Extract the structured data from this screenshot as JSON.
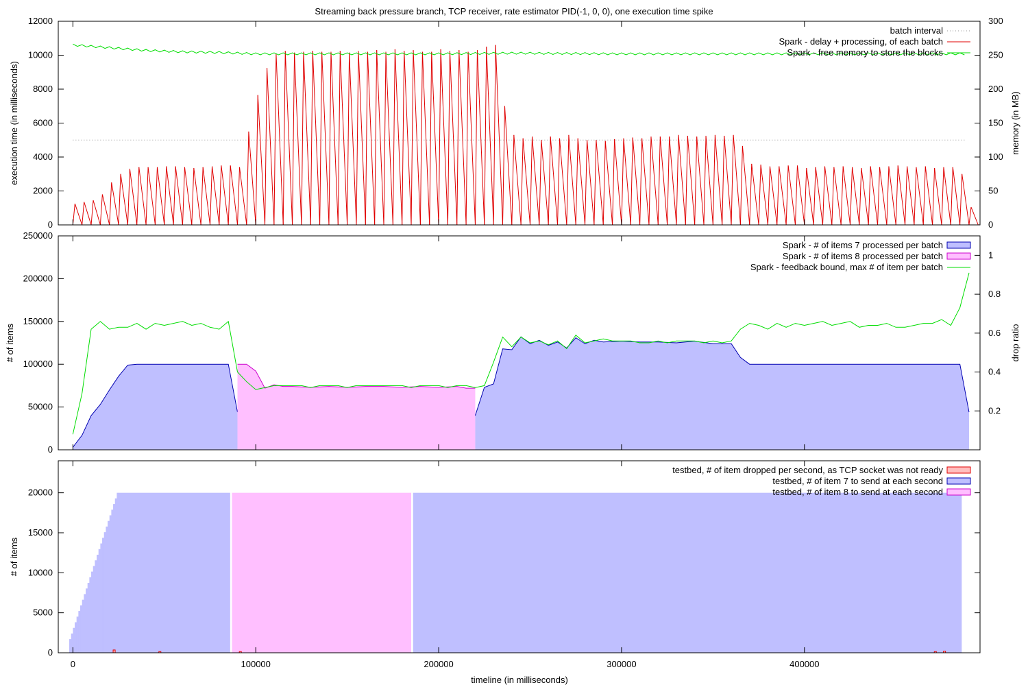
{
  "title": "Streaming back pressure branch, TCP receiver, rate estimator PID(-1, 0, 0), one execution time spike",
  "x_label": "timeline (in milliseconds)",
  "x_ticks": [
    0,
    100000,
    200000,
    300000,
    400000
  ],
  "x_tick_labels": [
    "0",
    "100000",
    "200000",
    "300000",
    "400000"
  ],
  "colors": {
    "red": "#e00000",
    "green": "#00dd00",
    "blue": "#0000b0",
    "blue_fill": "#bfbfff",
    "pink": "#ffbfff",
    "pink_edge": "#cc00cc",
    "drop_fill": "#ffbfbf"
  },
  "chart_data": [
    {
      "type": "line",
      "panel": "execution",
      "xlim": [
        -8000,
        496000
      ],
      "ylim": [
        0,
        12000
      ],
      "y2lim": [
        0,
        300
      ],
      "ylabel": "execution time (in milliseconds)",
      "y2label": "memory (in MB)",
      "y_ticks": [
        0,
        2000,
        4000,
        6000,
        8000,
        10000,
        12000
      ],
      "y2_ticks": [
        0,
        50,
        100,
        150,
        200,
        250,
        300
      ],
      "legend": "top-right",
      "series": [
        {
          "name": "batch interval",
          "style": "dotted",
          "x": [
            0,
            488000
          ],
          "y": [
            5000,
            5000
          ]
        },
        {
          "name": "Spark - delay + processing, of each batch",
          "style": "sawtooth",
          "x": [
            0,
            5000,
            10000,
            15000,
            20000,
            25000,
            30000,
            35000,
            40000,
            45000,
            50000,
            55000,
            60000,
            65000,
            70000,
            75000,
            80000,
            85000,
            90000,
            95000,
            100000,
            105000,
            110000,
            115000,
            120000,
            125000,
            130000,
            135000,
            140000,
            145000,
            150000,
            155000,
            160000,
            165000,
            170000,
            175000,
            180000,
            185000,
            190000,
            195000,
            200000,
            205000,
            210000,
            215000,
            220000,
            225000,
            230000,
            235000,
            240000,
            245000,
            250000,
            255000,
            260000,
            265000,
            270000,
            275000,
            280000,
            285000,
            290000,
            295000,
            300000,
            305000,
            310000,
            315000,
            320000,
            325000,
            330000,
            335000,
            340000,
            345000,
            350000,
            355000,
            360000,
            365000,
            370000,
            375000,
            380000,
            385000,
            390000,
            395000,
            400000,
            405000,
            410000,
            415000,
            420000,
            425000,
            430000,
            435000,
            440000,
            445000,
            450000,
            455000,
            460000,
            465000,
            470000,
            475000,
            480000,
            485000,
            490000
          ],
          "y": [
            1250,
            1350,
            1450,
            1800,
            2500,
            3000,
            3300,
            3400,
            3400,
            3400,
            3450,
            3450,
            3400,
            3350,
            3400,
            3450,
            3500,
            3500,
            3400,
            5500,
            7650,
            9250,
            10100,
            10250,
            10150,
            10200,
            10250,
            10200,
            10200,
            10250,
            10150,
            10250,
            10200,
            10300,
            10200,
            10350,
            10250,
            10300,
            10200,
            10200,
            10350,
            10250,
            10300,
            10200,
            10300,
            10500,
            10600,
            7000,
            5300,
            5100,
            5200,
            5000,
            5200,
            5100,
            5300,
            5100,
            5000,
            5000,
            4950,
            5050,
            5100,
            5150,
            5100,
            5200,
            5200,
            5200,
            5300,
            5250,
            5200,
            5250,
            5300,
            5250,
            5300,
            4650,
            3600,
            3550,
            3450,
            3450,
            3500,
            3500,
            3350,
            3400,
            3450,
            3400,
            3450,
            3400,
            3350,
            3450,
            3400,
            3450,
            3500,
            3450,
            3400,
            3450,
            3350,
            3400,
            3400,
            3000,
            1050
          ]
        },
        {
          "name": "Spark - free memory to store the blocks",
          "axis": "y2",
          "x": [
            0,
            20000,
            40000,
            60000,
            80000,
            100000,
            120000,
            200000,
            240000,
            300000,
            400000,
            488000
          ],
          "y": [
            265,
            261,
            257,
            255,
            254,
            252,
            252,
            252,
            253,
            252,
            252,
            252
          ]
        }
      ]
    },
    {
      "type": "area",
      "panel": "items",
      "xlim": [
        -8000,
        496000
      ],
      "ylim": [
        0,
        250000
      ],
      "y2lim": [
        0,
        1.1
      ],
      "ylabel": "# of items",
      "y2label": "drop ratio",
      "y_ticks": [
        0,
        50000,
        100000,
        150000,
        200000,
        250000
      ],
      "y2_ticks": [
        0.2,
        0.4,
        0.6,
        0.8,
        1
      ],
      "y2_tick_labels": [
        "0.2",
        "0.4",
        "0.6",
        "0.8",
        "1"
      ],
      "legend": "top-right",
      "series": [
        {
          "name": "Spark - # of items 7 processed per batch",
          "x": [
            0,
            5000,
            10000,
            15000,
            20000,
            25000,
            30000,
            35000,
            40000,
            50000,
            60000,
            70000,
            80000,
            85000,
            90000
          ],
          "y": [
            3000,
            17000,
            40000,
            53000,
            70000,
            86000,
            99000,
            100000,
            100000,
            100000,
            100000,
            100000,
            100000,
            100000,
            44000
          ]
        },
        {
          "name": "Spark - # of items 8 processed per batch",
          "x": [
            90000,
            95000,
            100000,
            105000,
            110000,
            115000,
            120000,
            130000,
            140000,
            150000,
            160000,
            170000,
            180000,
            190000,
            200000,
            210000,
            215000,
            220000
          ],
          "y": [
            100000,
            100000,
            92000,
            72000,
            76000,
            74000,
            74000,
            73000,
            74000,
            73000,
            74000,
            74000,
            73000,
            74000,
            73000,
            74000,
            72000,
            72000
          ]
        },
        {
          "name": "Spark - # of items 7 processed per batch",
          "x": [
            220000,
            225000,
            230000,
            235000,
            240000,
            245000,
            250000,
            255000,
            260000,
            265000,
            270000,
            275000,
            280000,
            285000,
            290000,
            300000,
            310000,
            320000,
            330000,
            340000,
            350000,
            360000,
            365000,
            370000,
            380000,
            400000,
            420000,
            440000,
            460000,
            480000,
            485000,
            490000
          ],
          "y": [
            40000,
            73000,
            77000,
            118000,
            117000,
            132000,
            124000,
            128000,
            122000,
            126000,
            119000,
            131000,
            124000,
            128000,
            126000,
            127000,
            126000,
            126000,
            125000,
            127000,
            124000,
            124000,
            108000,
            100000,
            100000,
            100000,
            100000,
            100000,
            100000,
            100000,
            100000,
            44000
          ]
        },
        {
          "name": "Spark - feedback bound, max # of item per batch",
          "axis": "y2",
          "x": [
            0,
            5000,
            10000,
            15000,
            20000,
            25000,
            30000,
            35000,
            40000,
            45000,
            50000,
            55000,
            60000,
            65000,
            70000,
            75000,
            80000,
            85000,
            90000,
            95000,
            100000,
            105000,
            110000,
            115000,
            120000,
            125000,
            130000,
            135000,
            140000,
            145000,
            150000,
            155000,
            160000,
            165000,
            170000,
            175000,
            180000,
            185000,
            190000,
            195000,
            200000,
            205000,
            210000,
            215000,
            220000,
            225000,
            230000,
            235000,
            240000,
            245000,
            250000,
            255000,
            260000,
            265000,
            270000,
            275000,
            280000,
            285000,
            290000,
            295000,
            300000,
            305000,
            310000,
            315000,
            320000,
            325000,
            330000,
            335000,
            340000,
            345000,
            350000,
            355000,
            360000,
            365000,
            370000,
            375000,
            380000,
            385000,
            390000,
            395000,
            400000,
            405000,
            410000,
            415000,
            420000,
            425000,
            430000,
            435000,
            440000,
            445000,
            450000,
            455000,
            460000,
            465000,
            470000,
            475000,
            480000,
            485000,
            490000
          ],
          "y": [
            0.08,
            0.29,
            0.62,
            0.66,
            0.62,
            0.63,
            0.63,
            0.65,
            0.62,
            0.65,
            0.64,
            0.65,
            0.66,
            0.64,
            0.65,
            0.63,
            0.62,
            0.66,
            0.4,
            0.35,
            0.31,
            0.32,
            0.33,
            0.33,
            0.33,
            0.33,
            0.32,
            0.33,
            0.33,
            0.33,
            0.32,
            0.33,
            0.33,
            0.33,
            0.33,
            0.33,
            0.33,
            0.32,
            0.33,
            0.33,
            0.33,
            0.32,
            0.33,
            0.33,
            0.32,
            0.33,
            0.45,
            0.58,
            0.53,
            0.58,
            0.55,
            0.56,
            0.54,
            0.56,
            0.52,
            0.59,
            0.55,
            0.56,
            0.57,
            0.56,
            0.56,
            0.56,
            0.55,
            0.55,
            0.56,
            0.55,
            0.56,
            0.56,
            0.56,
            0.55,
            0.56,
            0.55,
            0.56,
            0.62,
            0.65,
            0.64,
            0.62,
            0.65,
            0.63,
            0.65,
            0.64,
            0.65,
            0.66,
            0.64,
            0.65,
            0.66,
            0.63,
            0.64,
            0.64,
            0.65,
            0.63,
            0.63,
            0.64,
            0.65,
            0.65,
            0.67,
            0.64,
            0.73,
            0.91
          ]
        }
      ]
    },
    {
      "type": "bar",
      "panel": "testbed",
      "xlim": [
        -8000,
        496000
      ],
      "ylim": [
        0,
        24000
      ],
      "ylabel": "# of items",
      "y_ticks": [
        0,
        5000,
        10000,
        15000,
        20000
      ],
      "legend": "top-right",
      "series": [
        {
          "name": "testbed, # of item dropped per second, as TCP socket was not ready",
          "x": [
            22000,
            47000,
            91000,
            471000,
            476000
          ],
          "y": [
            350,
            150,
            150,
            150,
            200
          ]
        },
        {
          "name": "testbed, # of item 7 to send at each second",
          "segments": [
            {
              "x_start": -2000,
              "x_end": 25000,
              "y_start": 1000,
              "y_end": 20000,
              "ramp": true
            },
            {
              "x_start": 25000,
              "x_end": 86000,
              "y": 20000
            },
            {
              "x_start": 186000,
              "x_end": 486000,
              "y": 20000
            }
          ]
        },
        {
          "name": "testbed, # of item 8 to send at each second",
          "segments": [
            {
              "x_start": 87000,
              "x_end": 185000,
              "y": 20000
            }
          ]
        }
      ]
    }
  ]
}
